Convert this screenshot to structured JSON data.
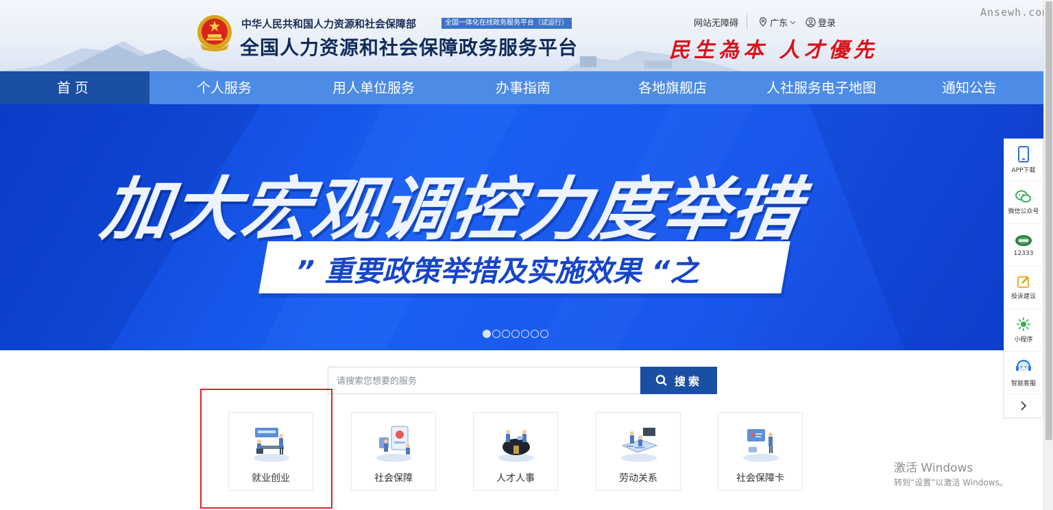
{
  "header": {
    "ministry": "中华人民共和国人力资源和社会保障部",
    "tag": "全国一体化在线政务服务平台（试运行）",
    "title": "全国人力资源和社会保障政务服务平台",
    "slogan": "民生為本 人才優先",
    "accessibility": "网站无障碍",
    "region": "广东",
    "login": "登录",
    "watermark": "Ansewh.com"
  },
  "nav": {
    "items": [
      "首页",
      "个人服务",
      "用人单位服务",
      "办事指南",
      "各地旗舰店",
      "人社服务电子地图",
      "通知公告"
    ],
    "active_index": 0
  },
  "banner": {
    "title": "加大宏观调控力度举措",
    "subtitle": "” 重要政策举措及实施效果 “之",
    "slides": 7,
    "active_slide": 0
  },
  "sidebar": {
    "items": [
      {
        "label": "APP下载",
        "icon": "phone-icon"
      },
      {
        "label": "微信公众号",
        "icon": "wechat-icon"
      },
      {
        "label": "12333",
        "icon": "hotline-12333-icon"
      },
      {
        "label": "投诉建议",
        "icon": "edit-icon"
      },
      {
        "label": "小程序",
        "icon": "mini-program-icon"
      },
      {
        "label": "智能客服",
        "icon": "headset-icon"
      }
    ]
  },
  "search": {
    "placeholder": "请搜索您想要的服务",
    "value": "",
    "button": "搜索"
  },
  "services": [
    {
      "label": "就业创业",
      "icon": "employment-icon"
    },
    {
      "label": "社会保障",
      "icon": "social-security-icon"
    },
    {
      "label": "人才人事",
      "icon": "talent-icon"
    },
    {
      "label": "劳动关系",
      "icon": "labor-relations-icon"
    },
    {
      "label": "社会保障卡",
      "icon": "ss-card-icon"
    }
  ],
  "activation": {
    "line1": "激活 Windows",
    "line2": "转到“设置”以激活 Windows。"
  },
  "colors": {
    "nav": "#4c8be6",
    "nav_active": "#1a4fa3",
    "banner": "#1a5ff2",
    "slogan": "#d7141a",
    "highlight": "#e02525"
  }
}
